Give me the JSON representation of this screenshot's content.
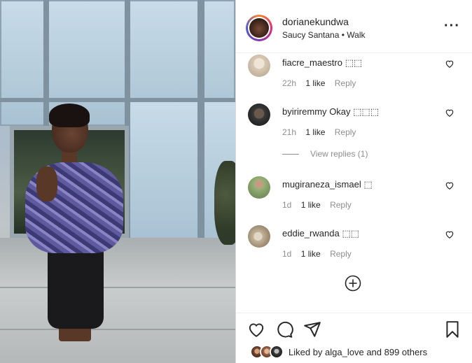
{
  "post": {
    "owner": "dorianekundwa",
    "audio": "Saucy Santana",
    "separator": "•",
    "location": "Walk",
    "more_icon": "more-icon"
  },
  "comments": [
    {
      "user": "fiacre_maestro",
      "text": "⬚⬚",
      "age": "22h",
      "likes": "1 like",
      "reply": "Reply",
      "avatar_color": "#d8c9b6"
    },
    {
      "user": "byiriremmy",
      "text": "Okay ⬚⬚⬚",
      "age": "21h",
      "likes": "1 like",
      "reply": "Reply",
      "avatar_color": "#3a3a3a"
    },
    {
      "user": "mugiraneza_ismael",
      "text": "⬚",
      "age": "1d",
      "likes": "1 like",
      "reply": "Reply",
      "avatar_color": "#9bb37a"
    },
    {
      "user": "eddie_rwanda",
      "text": "⬚⬚",
      "age": "1d",
      "likes": "1 like",
      "reply": "Reply",
      "avatar_color": "#c3b49a"
    }
  ],
  "view_replies": "View replies (1)",
  "likes": {
    "prefix": "Liked by",
    "user": "alga_love",
    "suffix": "and 899 others"
  },
  "icons": {
    "heart": "heart-icon",
    "comment": "comment-icon",
    "share": "share-icon",
    "save": "bookmark-icon",
    "load_more": "plus-circle-icon"
  }
}
